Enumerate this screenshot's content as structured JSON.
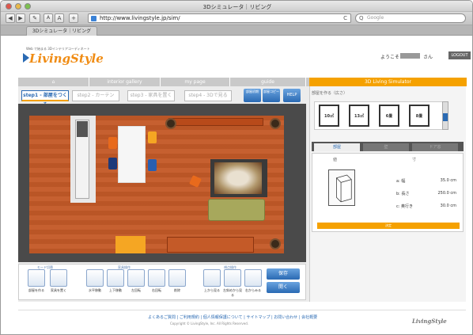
{
  "window": {
    "title": "3Dシミュレータ｜リビング"
  },
  "browser": {
    "url": "http://www.livingstyle.jp/sim/",
    "search_placeholder": "Google",
    "back": "◀",
    "forward": "▶",
    "reload": "C",
    "tab_label": "3Dシミュレータ｜リビング"
  },
  "header": {
    "tagline": "Web で始まる 3Dインテリアコーディネート",
    "logo": "LivingStyle",
    "welcome": "ようこそ",
    "san": "さん",
    "logout": "LOGOUT"
  },
  "nav": [
    "",
    "interior gallery",
    "my page",
    "guide",
    "3D Living Simulator"
  ],
  "steps": [
    {
      "label": "step1 - 部屋をつくる",
      "active": true
    },
    {
      "label": "step2 - カーテン",
      "active": false
    },
    {
      "label": "step3 - 家具を置く",
      "active": false
    },
    {
      "label": "step4 - 3Dで見る",
      "active": false
    }
  ],
  "step_buttons": [
    "部屋初期",
    "部屋コピー",
    "HELP"
  ],
  "tools": {
    "group1": "モード切替",
    "group2": "家具操作",
    "group3": "視点操作",
    "captions": [
      "部屋を作る",
      "家具を置く",
      "水平移動",
      "上下移動",
      "左回転",
      "右回転",
      "削除",
      "上から見る",
      "左斜めから見る",
      "右からみる"
    ],
    "save": "保存",
    "open": "開く"
  },
  "side": {
    "top_label": "部屋を作る（広さ）",
    "furniture": [
      "10㎡",
      "13㎡",
      "6畳",
      "8畳"
    ],
    "prop_tabs": [
      "部屋",
      "壁",
      "ドア窓"
    ],
    "col_headers": [
      "値",
      "寸"
    ],
    "props": [
      {
        "label": "a: 幅",
        "value": "35.0 cm"
      },
      {
        "label": "b: 長さ",
        "value": "250.0 cm"
      },
      {
        "label": "c: 奥行き",
        "value": "30.0 cm"
      }
    ],
    "decide": "決定"
  },
  "footer": {
    "links": "よくあるご質問 | ご利用規約 | 個人情報保護について | サイトマップ | お問い合わせ | 会社概要",
    "copyright": "Copyright © LivingStyle, Inc. All Rights Reserved.",
    "logo": "LivingStyle"
  },
  "colors": {
    "accent": "#f5a100",
    "brand_blue": "#2a6ab3",
    "floor": "#c45a28"
  }
}
